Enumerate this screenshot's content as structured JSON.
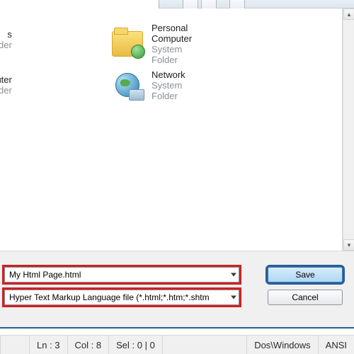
{
  "locations": {
    "partial1": {
      "title_suffix": "s",
      "sub": "Folder"
    },
    "partial2": {
      "title_suffix": "puter",
      "sub": "Folder"
    },
    "personal": {
      "title": "Personal Computer",
      "sub": "System Folder"
    },
    "network": {
      "title": "Network",
      "sub": "System Folder"
    }
  },
  "fields": {
    "filename": "My Html Page.html",
    "filetype": "Hyper Text Markup Language file (*.html;*.htm;*.shtm"
  },
  "buttons": {
    "save": "Save",
    "cancel": "Cancel"
  },
  "status": {
    "ln": "Ln : 3",
    "col": "Col : 8",
    "sel": "Sel : 0 | 0",
    "eol": "Dos\\Windows",
    "enc": "ANSI"
  }
}
